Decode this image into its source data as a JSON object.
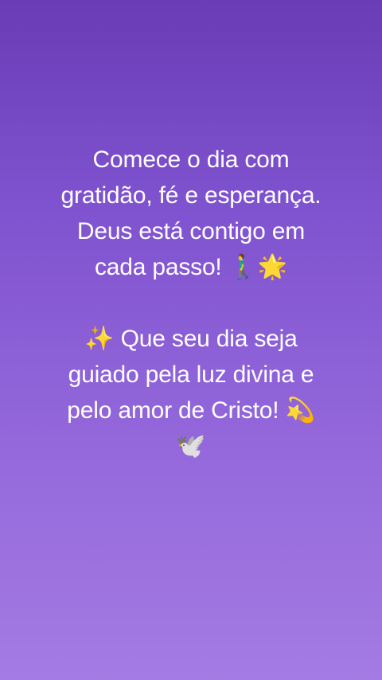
{
  "post": {
    "paragraph_1": [
      "Comece o dia com",
      "gratidão, fé e esperança.",
      "Deus está contigo em",
      "cada passo! 🚶‍♂️🌟"
    ],
    "paragraph_2": [
      "✨ Que seu dia seja",
      "guiado pela luz divina e",
      "pelo amor de Cristo! 💫",
      "🕊️"
    ]
  },
  "colors": {
    "background_top": "#6a3cb6",
    "background_bottom": "#a47ae3",
    "text": "#ffffff"
  }
}
